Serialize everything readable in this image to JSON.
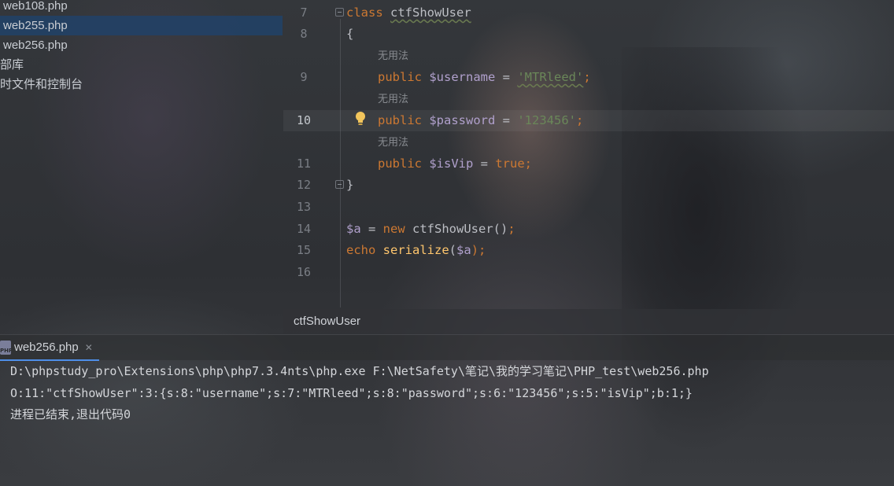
{
  "project_tree": {
    "items": [
      {
        "label": "web108.php"
      },
      {
        "label": "web255.php",
        "selected": true
      },
      {
        "label": "web256.php"
      },
      {
        "label": "部库"
      },
      {
        "label": "时文件和控制台"
      }
    ]
  },
  "editor": {
    "line_numbers": [
      "7",
      "8",
      "9",
      "10",
      "11",
      "12",
      "13",
      "14",
      "15",
      "16"
    ],
    "current_line": "10",
    "inlay_hint": "无用法",
    "code": {
      "l7_kw": "class",
      "l7_name": "ctfShowUser",
      "l8": "{",
      "l9_kw": "public",
      "l9_var": "$username",
      "l9_eq": " = ",
      "l9_str": "'MTRleed'",
      "l9_semi": ";",
      "l10_kw": "public",
      "l10_var": "$password",
      "l10_eq": " = ",
      "l10_str": "'123456'",
      "l10_semi": ";",
      "l11_kw": "public",
      "l11_var": "$isVip",
      "l11_eq": " = ",
      "l11_val": "true",
      "l11_semi": ";",
      "l12": "}",
      "l14_var": "$a",
      "l14_eq": " = ",
      "l14_kw": "new",
      "l14_call": " ctfShowUser()",
      "l14_semi": ";",
      "l15_kw": "echo",
      "l15_fn": "serialize",
      "l15_open": "(",
      "l15_var": "$a",
      "l15_close": ");"
    },
    "colors": {
      "keyword": "#cc7832",
      "variable": "#b0a0cc",
      "string": "#6a8759",
      "function": "#ffc66d"
    }
  },
  "breadcrumb": {
    "label": "ctfShowUser"
  },
  "run_panel": {
    "tab_label": "web256.php",
    "tab_icon_text": "PHP",
    "console_lines": [
      "D:\\phpstudy_pro\\Extensions\\php\\php7.3.4nts\\php.exe F:\\NetSafety\\笔记\\我的学习笔记\\PHP_test\\web256.php",
      "O:11:\"ctfShowUser\":3:{s:8:\"username\";s:7:\"MTRleed\";s:8:\"password\";s:6:\"123456\";s:5:\"isVip\";b:1;}",
      "进程已结束,退出代码0"
    ]
  }
}
